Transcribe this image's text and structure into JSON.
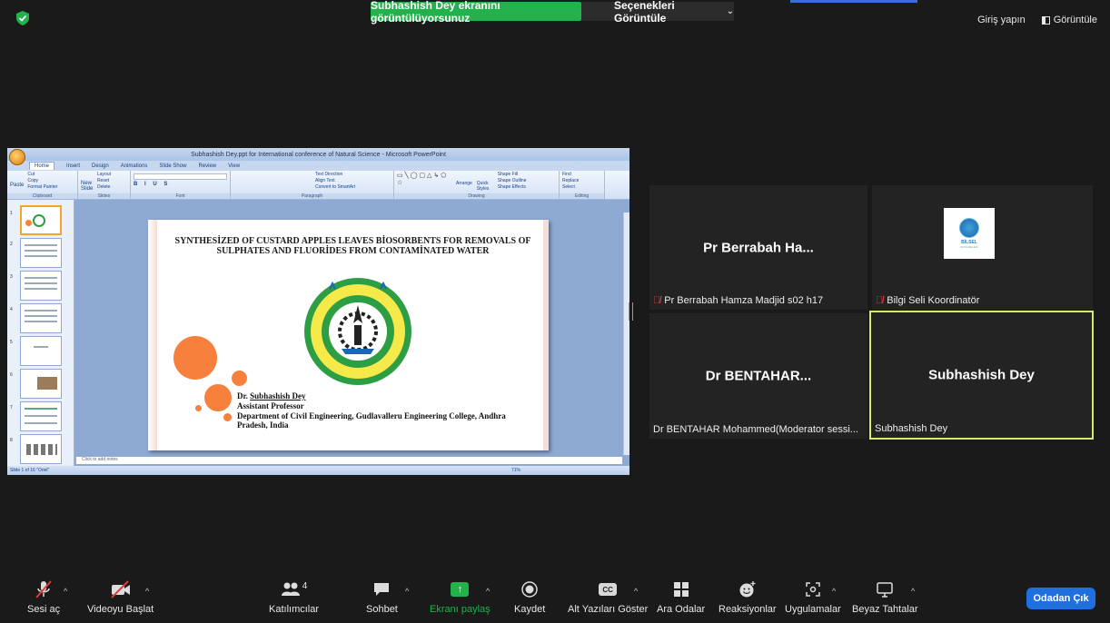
{
  "top_bar": {
    "share_banner": "Subhashish Dey ekranını görüntülüyorsunuz",
    "view_options": "Seçenekleri Görüntüle",
    "sign_in": "Giriş yapın",
    "view": "Görüntüle"
  },
  "shared_screen": {
    "window_title": "Subhashish Dey.ppt for International conference of Natural Science - Microsoft PowerPoint",
    "tabs": [
      "Home",
      "Insert",
      "Design",
      "Animations",
      "Slide Show",
      "Review",
      "View"
    ],
    "ribbon": {
      "clipboard": {
        "label": "Clipboard",
        "items": [
          "Cut",
          "Copy",
          "Format Painter"
        ],
        "paste": "Paste"
      },
      "slides": {
        "label": "Slides",
        "items": [
          "Layout",
          "Reset",
          "Delete"
        ],
        "new": "New Slide"
      },
      "font": {
        "label": "Font"
      },
      "paragraph": {
        "label": "Paragraph",
        "items": [
          "Text Direction",
          "Align Text",
          "Convert to SmartArt"
        ]
      },
      "drawing": {
        "label": "Drawing",
        "items": [
          "Shape Fill",
          "Shape Outline",
          "Shape Effects"
        ],
        "arrange": "Arrange",
        "quick": "Quick Styles"
      },
      "editing": {
        "label": "Editing",
        "items": [
          "Find",
          "Replace",
          "Select"
        ]
      }
    },
    "thumbnail_numbers": [
      "1",
      "2",
      "3",
      "4",
      "5",
      "6",
      "7",
      "8"
    ],
    "slide": {
      "title": "SYNTHESİZED OF CUSTARD APPLES LEAVES BİOSORBENTS FOR REMOVALS OF SULPHATES AND FLUORİDES FROM CONTAMİNATED WATER",
      "author_prefix": "Dr. ",
      "author_name": "Subhashish Dey",
      "position": "Assistant Professor",
      "dept": "Department of Civil Engineering, Gudlavalleru Engineering College, Andhra Pradesh, India",
      "emblem_text": "GUDLAVALLERU ENGINEERING COLLEGE",
      "emblem_initials": "GEC"
    },
    "notes_placeholder": "Click to add notes",
    "status": "Slide 1 of 16   \"Oriel\"",
    "zoom": "71%"
  },
  "participants": [
    {
      "display": "Pr Berrabah Ha...",
      "label": "Pr Berrabah Hamza Madjid s02 h17",
      "muted": true
    },
    {
      "display": "",
      "label": "Bilgi Seli Koordinatör",
      "muted": true,
      "logo_text": "BİLSEL",
      "logo_sub": "KONGRELERİ"
    },
    {
      "display": "Dr  BENTAHAR...",
      "label": "Dr BENTAHAR Mohammed(Moderator sessi...",
      "muted": false
    },
    {
      "display": "Subhashish Dey",
      "label": "Subhashish Dey",
      "muted": false,
      "active": true
    }
  ],
  "toolbar": {
    "unmute": "Sesi aç",
    "start_video": "Videoyu Başlat",
    "participants": "Katılımcılar",
    "participant_count": "4",
    "chat": "Sohbet",
    "share_screen": "Ekranı paylaş",
    "record": "Kaydet",
    "captions": "Alt Yazıları Göster",
    "cc": "CC",
    "breakout": "Ara Odalar",
    "reactions": "Reaksiyonlar",
    "apps": "Uygulamalar",
    "whiteboards": "Beyaz Tahtalar",
    "leave": "Odadan Çık"
  },
  "colors": {
    "share_green": "#22b14c",
    "active_tile": "#d8e872",
    "leave_blue": "#1f6fe0",
    "muted_red": "#e0393e"
  }
}
